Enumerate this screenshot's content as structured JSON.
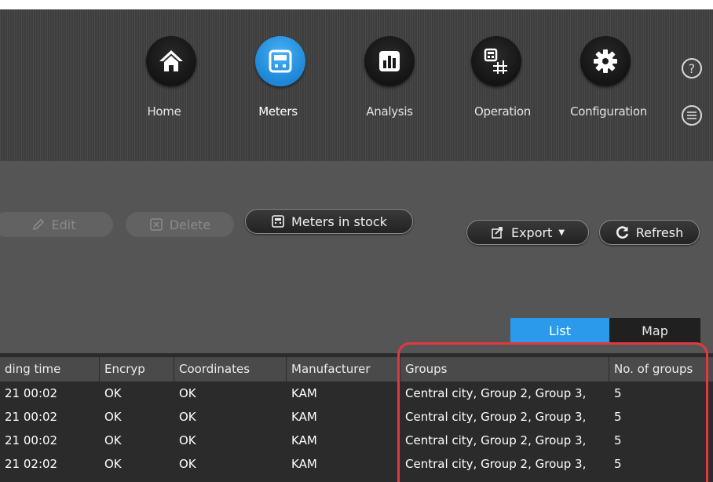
{
  "nav": {
    "home_label": "Home",
    "meters_label": "Meters",
    "analysis_label": "Analysis",
    "operation_label": "Operation",
    "configuration_label": "Configuration",
    "help_glyph": "?",
    "active": "Meters",
    "accent_color": "#2b9aeb"
  },
  "toolbar": {
    "edit_label": "Edit",
    "delete_label": "Delete",
    "meters_in_stock_label": "Meters in stock",
    "export_label": "Export",
    "refresh_label": "Refresh"
  },
  "view_toggle": {
    "list_label": "List",
    "map_label": "Map",
    "selected": "List"
  },
  "table": {
    "columns": [
      "ding time",
      "Encryp",
      "Coordinates",
      "Manufacturer",
      "Groups",
      "No. of groups"
    ],
    "rows": [
      [
        "21 00:02",
        "OK",
        "OK",
        "KAM",
        "Central city, Group 2, Group 3,",
        "5"
      ],
      [
        "21 00:02",
        "OK",
        "OK",
        "KAM",
        "Central city, Group 2, Group 3,",
        "5"
      ],
      [
        "21 00:02",
        "OK",
        "OK",
        "KAM",
        "Central city, Group 2, Group 3,",
        "5"
      ],
      [
        "21 02:02",
        "OK",
        "OK",
        "KAM",
        "Central city, Group 2, Group 3,",
        "5"
      ]
    ]
  },
  "highlight_color": "#e0393f"
}
